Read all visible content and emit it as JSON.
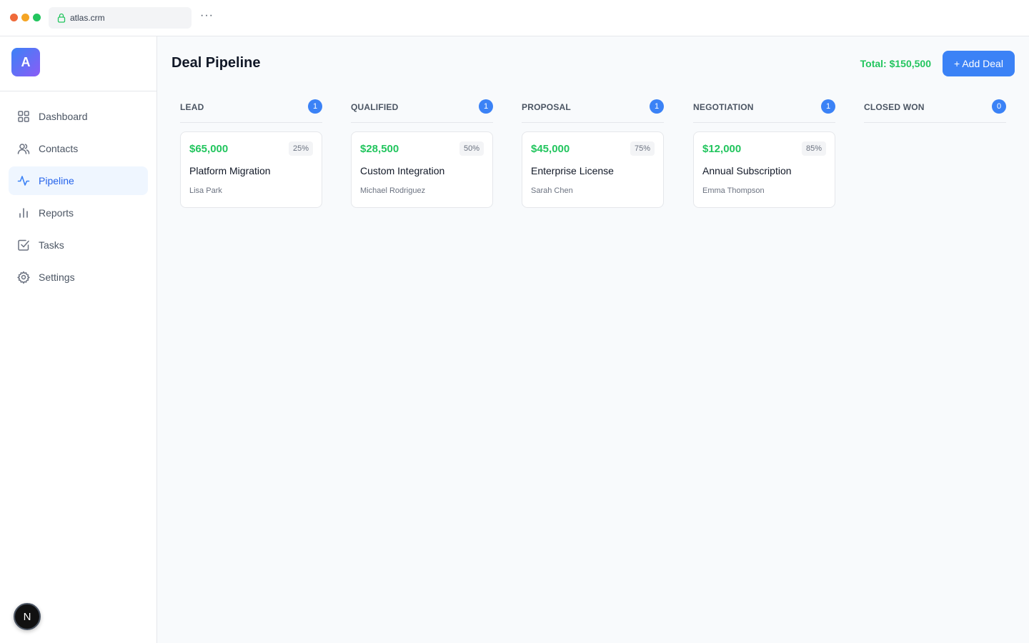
{
  "browser": {
    "url": "atlas.crm",
    "more_label": "···"
  },
  "sidebar": {
    "brand_letter": "A",
    "items": [
      {
        "label": "Dashboard",
        "icon": "grid-icon"
      },
      {
        "label": "Contacts",
        "icon": "users-icon"
      },
      {
        "label": "Pipeline",
        "icon": "activity-icon",
        "active": true
      },
      {
        "label": "Reports",
        "icon": "bar-chart-icon"
      },
      {
        "label": "Tasks",
        "icon": "checkbox-icon"
      },
      {
        "label": "Settings",
        "icon": "gear-icon"
      }
    ],
    "framework_badge": "N"
  },
  "main": {
    "title": "Deal Pipeline",
    "total": "Total: $150,500",
    "add_label": "+ Add Deal"
  },
  "columns": [
    {
      "title": "LEAD",
      "count": "1",
      "deals": [
        {
          "value": "$65,000",
          "probability": "25%",
          "name": "Platform Migration",
          "owner": "Lisa Park"
        }
      ]
    },
    {
      "title": "QUALIFIED",
      "count": "1",
      "deals": [
        {
          "value": "$28,500",
          "probability": "50%",
          "name": "Custom Integration",
          "owner": "Michael Rodriguez"
        }
      ]
    },
    {
      "title": "PROPOSAL",
      "count": "1",
      "deals": [
        {
          "value": "$45,000",
          "probability": "75%",
          "name": "Enterprise License",
          "owner": "Sarah Chen"
        }
      ]
    },
    {
      "title": "NEGOTIATION",
      "count": "1",
      "deals": [
        {
          "value": "$12,000",
          "probability": "85%",
          "name": "Annual Subscription",
          "owner": "Emma Thompson"
        }
      ]
    },
    {
      "title": "CLOSED WON",
      "count": "0",
      "deals": []
    }
  ],
  "colors": {
    "accent": "#3b82f6",
    "money": "#22c55e",
    "active_bg": "#eff6ff"
  }
}
